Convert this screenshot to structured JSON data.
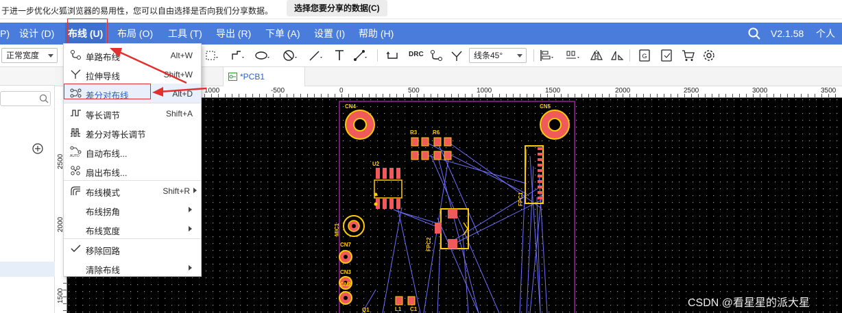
{
  "notification": {
    "text": "于进一步优化火狐浏览器的易用性，您可以自由选择是否向我们分享数据。",
    "button": "选择您要分享的数据(C)"
  },
  "menubar": {
    "items": [
      "P)",
      "设计 (D)",
      "布线 (U)",
      "布局 (O)",
      "工具 (T)",
      "导出 (R)",
      "下单 (A)",
      "设置 (I)",
      "帮助 (H)"
    ],
    "version": "V2.1.58",
    "personal": "个人"
  },
  "toolbar": {
    "line_width": "正常宽度",
    "corner": "线条45°",
    "drc": "DRC"
  },
  "tab": {
    "label": "*PCB1"
  },
  "ruler": {
    "h_labels": [
      "1000",
      "-500",
      "0",
      "500",
      "1000",
      "1500",
      "2000",
      "2500",
      "3000",
      "3500"
    ],
    "v_labels": [
      "2500",
      "2000",
      "1500"
    ]
  },
  "routing_menu": {
    "items": [
      {
        "label": "单路布线",
        "shortcut": "Alt+W",
        "icon": "single-route-icon"
      },
      {
        "label": "拉伸导线",
        "shortcut": "Shift+W",
        "icon": "stretch-track-icon"
      },
      {
        "label": "差分对布线",
        "shortcut": "Alt+D",
        "icon": "diff-pair-icon"
      },
      {
        "label": "等长调节",
        "shortcut": "Shift+A",
        "icon": "length-tune-icon"
      },
      {
        "label": "差分对等长调节",
        "shortcut": "",
        "icon": "diff-length-tune-icon"
      },
      {
        "label": "自动布线...",
        "shortcut": "",
        "icon": "auto-route-icon"
      },
      {
        "label": "扇出布线...",
        "shortcut": "",
        "icon": "fanout-icon"
      },
      {
        "label": "布线模式",
        "shortcut": "Shift+R",
        "icon": "route-mode-icon"
      },
      {
        "label": "布线拐角",
        "shortcut": "",
        "icon": ""
      },
      {
        "label": "布线宽度",
        "shortcut": "",
        "icon": ""
      },
      {
        "label": "移除回路",
        "shortcut": "",
        "icon": "check-icon"
      },
      {
        "label": "清除布线",
        "shortcut": "",
        "icon": ""
      }
    ]
  },
  "pcb": {
    "labels": [
      "CN4",
      "CN5",
      "R3",
      "R6",
      "U2",
      "FPC2",
      "FPC1",
      "MIC1",
      "CN7",
      "CN3",
      "CN2",
      "L1",
      "Q1",
      "C1"
    ]
  },
  "watermark": "CSDN @看星星的派大星",
  "colors": {
    "menubar": "#4a7ddb",
    "canvas": "#000000",
    "pad": "#f05a5a",
    "silk": "#ffcc00",
    "ratsnest": "#7070ff",
    "board_outline": "#a020a0",
    "annotation": "#e03030"
  }
}
